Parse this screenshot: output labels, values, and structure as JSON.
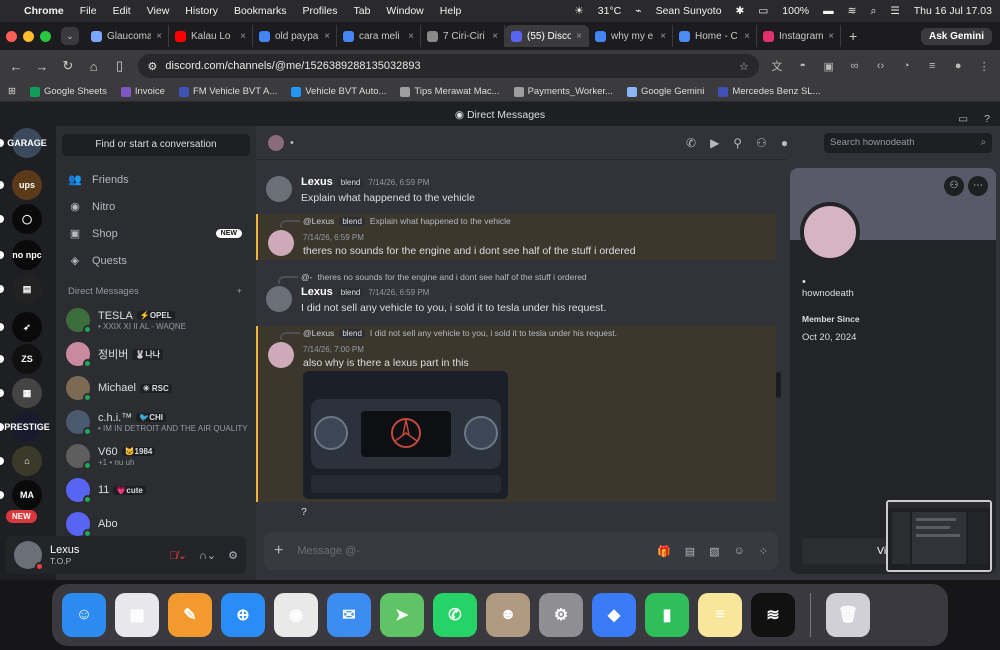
{
  "menubar": {
    "app": "Chrome",
    "items": [
      "File",
      "Edit",
      "View",
      "History",
      "Bookmarks",
      "Profiles",
      "Tab",
      "Window",
      "Help"
    ],
    "weather": "31°C",
    "user": "Sean Sunyoto",
    "battery": "100%",
    "clock": "Thu 16 Jul  17.03"
  },
  "tabs": [
    {
      "title": "Glaucoma",
      "color": "#7aa7ff"
    },
    {
      "title": "Kalau Lo",
      "color": "#ff0000"
    },
    {
      "title": "old paypa",
      "color": "#4285f4"
    },
    {
      "title": "cara meli",
      "color": "#4285f4"
    },
    {
      "title": "7 Ciri-Ciri",
      "color": "#8a8a8a"
    },
    {
      "title": "(55) Disco",
      "color": "#5865f2"
    },
    {
      "title": "why my e",
      "color": "#4285f4"
    },
    {
      "title": "Home - C",
      "color": "#4c8bf5"
    },
    {
      "title": "Instagram",
      "color": "#e1306c"
    }
  ],
  "ask_gemini": "Ask Gemini",
  "url": "discord.com/channels/@me/1526389288135032893",
  "bookmarks": [
    {
      "label": "Google Sheets",
      "color": "#0f9d58"
    },
    {
      "label": "Invoice",
      "color": "#7e57c2"
    },
    {
      "label": "FM Vehicle BVT A...",
      "color": "#3f51b5"
    },
    {
      "label": "Vehicle BVT Auto...",
      "color": "#2196f3"
    },
    {
      "label": "Tips Merawat Mac...",
      "color": "#9e9e9e"
    },
    {
      "label": "Payments_Worker...",
      "color": "#9e9e9e"
    },
    {
      "label": "Google Gemini",
      "color": "#8ab4f8"
    },
    {
      "label": "Mercedes Benz SL...",
      "color": "#3f51b5"
    }
  ],
  "discord": {
    "title": "Direct Messages",
    "find_placeholder": "Find or start a conversation",
    "nav": [
      {
        "label": "Friends",
        "icon": "friends-icon",
        "glyph": "👥"
      },
      {
        "label": "Nitro",
        "icon": "nitro-icon",
        "glyph": "◉"
      },
      {
        "label": "Shop",
        "icon": "shop-icon",
        "glyph": "▣"
      },
      {
        "label": "Quests",
        "icon": "quests-icon",
        "glyph": "◈"
      }
    ],
    "shop_badge": "NEW",
    "dm_header": "Direct Messages",
    "dm_add": "+",
    "dms": [
      {
        "name": "TESLA",
        "tag": "⚡OPEL",
        "sub": "• XXIX XI II AL - WAQNE",
        "color": "#3c6e3c"
      },
      {
        "name": "정비버",
        "tag": "🐰나나",
        "sub": "",
        "color": "#c98aa0"
      },
      {
        "name": "Michael",
        "tag": "✳ RSC",
        "sub": "",
        "color": "#7d6a55"
      },
      {
        "name": "c.h.i.™",
        "tag": "🐦CHI",
        "sub": "• IM IN DETROIT AND THE AIR QUALITY",
        "color": "#4a5a6e"
      },
      {
        "name": "V60",
        "tag": "🐱1984",
        "sub": "+1 • nu uh",
        "color": "#5e5e5e"
      },
      {
        "name": "11",
        "tag": "💗cute",
        "sub": "",
        "color": "#5865f2"
      },
      {
        "name": "Abo",
        "tag": "",
        "sub": "",
        "color": "#5865f2"
      }
    ],
    "user": {
      "name": "Lexus",
      "status": "T.O.P"
    },
    "new_badge": "NEW",
    "servers": [
      {
        "label": "GARAGE",
        "color": "#3a4a5c"
      },
      {
        "label": "ups",
        "color": "#5b3a1a"
      },
      {
        "label": "◯",
        "color": "#0a0a0a"
      },
      {
        "label": "no npc",
        "color": "#0a0a0a"
      },
      {
        "label": "▤",
        "color": "#222"
      },
      {
        "label": "➶",
        "color": "#0a0a0a"
      },
      {
        "label": "ZS",
        "color": "#101010"
      },
      {
        "label": "▦",
        "color": "#444"
      },
      {
        "label": "PRESTIGE",
        "color": "#1a1a2e"
      },
      {
        "label": "⌂",
        "color": "#3a3a2a"
      },
      {
        "label": "MA",
        "color": "#0a0a0a"
      }
    ]
  },
  "chat": {
    "header_dot": "•",
    "messages": [
      {
        "author": "Lexus",
        "badge": "blend",
        "time": "7/14/26, 6:59 PM",
        "text": "Explain what happened to the vehicle"
      },
      {
        "reply_author": "@Lexus",
        "reply_badge": "blend",
        "reply_text": "Explain what happened to the vehicle",
        "time": "7/14/26, 6:59 PM",
        "text": "theres no sounds for the engine and i dont see half of the stuff i ordered"
      },
      {
        "reply_author": "@-",
        "reply_text": "theres no sounds for the engine and i dont see half of the stuff i ordered",
        "author": "Lexus",
        "badge": "blend",
        "time": "7/14/26, 6:59 PM",
        "text": "I did not sell any vehicle to you, i sold it to tesla under his request."
      },
      {
        "reply_author": "@Lexus",
        "reply_badge": "blend",
        "reply_text": "I did not sell any vehicle to you, i sold it to tesla under his request.",
        "time": "7/14/26, 7:00 PM",
        "text": "also why is there a lexus part in this",
        "followup": "?"
      }
    ],
    "composer_placeholder": "Message @-"
  },
  "profile": {
    "search_placeholder": "Search hownodeath",
    "display_name": "•",
    "username": "hownodeath",
    "member_since_label": "Member Since",
    "member_since": "Oct 20, 2024",
    "view_button": "View F"
  },
  "dock": [
    {
      "name": "finder",
      "color": "#2c8bf0",
      "glyph": "☺"
    },
    {
      "name": "launchpad",
      "color": "#e8e8ec",
      "glyph": "▦"
    },
    {
      "name": "pages",
      "color": "#f29a2e",
      "glyph": "✎"
    },
    {
      "name": "safari",
      "color": "#2a8df7",
      "glyph": "⊕"
    },
    {
      "name": "chrome",
      "color": "#e9e9e9",
      "glyph": "◉"
    },
    {
      "name": "mail",
      "color": "#3d8cf2",
      "glyph": "✉"
    },
    {
      "name": "maps",
      "color": "#5fc466",
      "glyph": "➤"
    },
    {
      "name": "whatsapp",
      "color": "#25d366",
      "glyph": "✆"
    },
    {
      "name": "contacts",
      "color": "#b09a82",
      "glyph": "☻"
    },
    {
      "name": "system-settings",
      "color": "#8e8e93",
      "glyph": "⚙"
    },
    {
      "name": "roblox",
      "color": "#3a7bf7",
      "glyph": "◆"
    },
    {
      "name": "numbers",
      "color": "#2fbf5a",
      "glyph": "▮"
    },
    {
      "name": "notes",
      "color": "#f8e79a",
      "glyph": "≡"
    },
    {
      "name": "spotify",
      "color": "#111",
      "glyph": "≋"
    },
    {
      "name": "trash",
      "color": "#d0d0d6",
      "glyph": "🗑"
    }
  ]
}
